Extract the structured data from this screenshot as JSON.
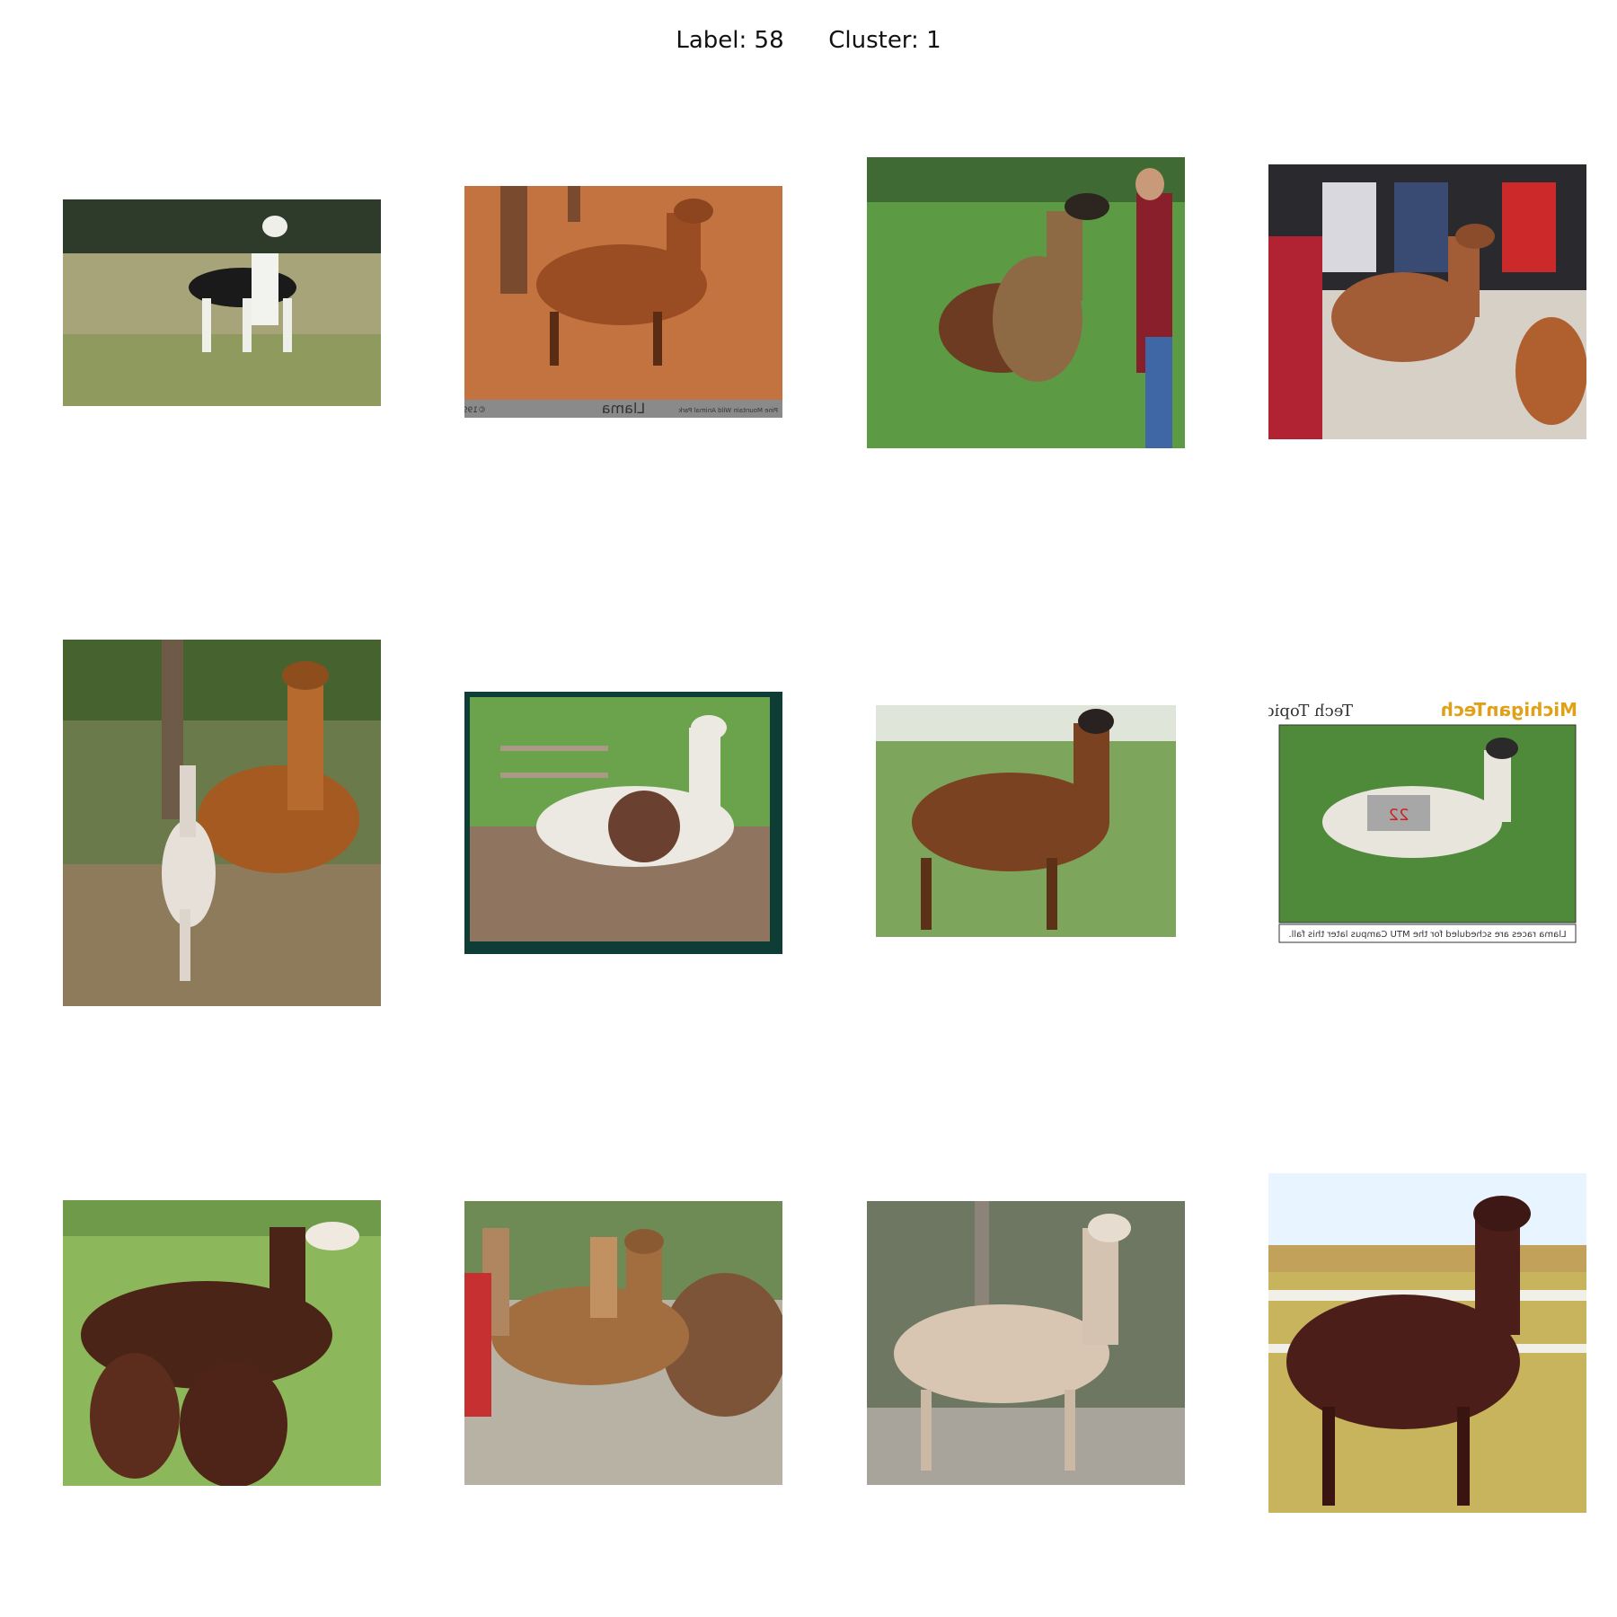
{
  "figure": {
    "label_text": "Label: 58",
    "cluster_text": "Cluster: 1"
  },
  "photos": [
    {
      "subject": "black and white llama in field"
    },
    {
      "subject": "brown llama walking on dirt",
      "caption_center": "Llama",
      "caption_left": "©1998 zoo.net",
      "caption_right": "Pine Mountain Wild Animal Park"
    },
    {
      "subject": "brown llama beside woman in grass"
    },
    {
      "subject": "brown llama among people at market"
    },
    {
      "subject": "ginger llama with spotted cria"
    },
    {
      "subject": "white and brown llama near fence"
    },
    {
      "subject": "dark brown llama on grass"
    },
    {
      "subject": "white llama with race number",
      "header_left": "Tech Topics",
      "header_right": "MichiganTech",
      "number": "22",
      "caption": "Llama races are scheduled for the MTU Campus later this fall."
    },
    {
      "subject": "dark brown llama with two crias"
    },
    {
      "subject": "group of tan llamas"
    },
    {
      "subject": "spotted llama walking"
    },
    {
      "subject": "dark brown llama by fence"
    }
  ]
}
